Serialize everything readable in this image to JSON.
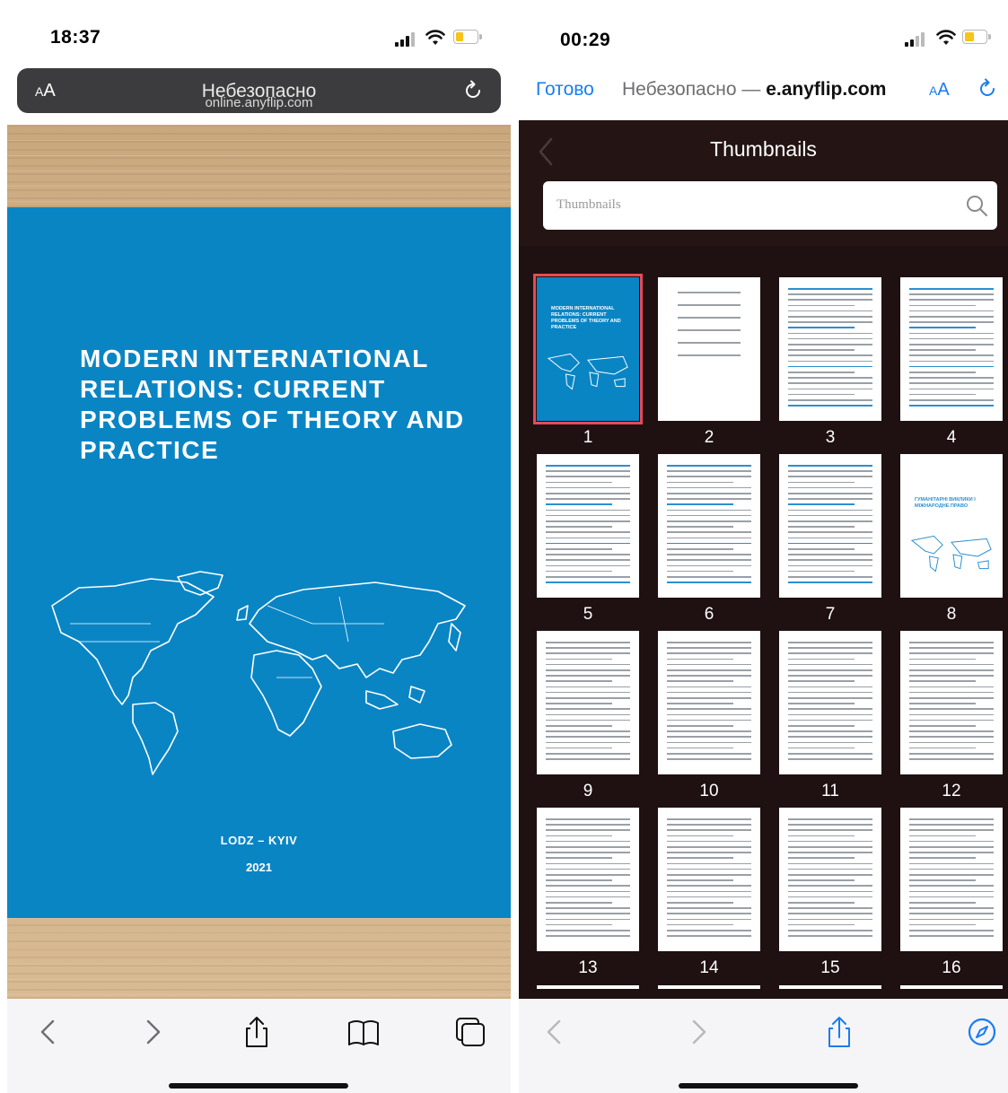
{
  "left_phone": {
    "status": {
      "time": "18:37"
    },
    "url_bar": {
      "text_size_label": "AA",
      "security_text": "Небезопасно",
      "domain": "online.anyflip.com"
    },
    "cover": {
      "title": "MODERN INTERNATIONAL RELATIONS: CURRENT PROBLEMS OF THEORY AND PRACTICE",
      "place": "LODZ – KYIV",
      "year": "2021"
    },
    "toolbar": [
      "back-icon",
      "forward-icon",
      "share-icon",
      "bookmarks-icon",
      "tabs-icon"
    ]
  },
  "right_phone": {
    "status": {
      "time": "00:29"
    },
    "url_bar": {
      "done_label": "Готово",
      "security_prefix": "Небезопасно — ",
      "domain_partial": "e.anyflip.com",
      "text_size_label": "AA"
    },
    "panel": {
      "title": "Thumbnails",
      "search_placeholder": "Thumbnails"
    },
    "thumbnail_pages": [
      "1",
      "2",
      "3",
      "4",
      "5",
      "6",
      "7",
      "8",
      "9",
      "10",
      "11",
      "12",
      "13",
      "14",
      "15",
      "16"
    ],
    "page8_title": "ГУМАНІТАРНІ ВИКЛИКИ І МІЖНАРОДНЕ ПРАВО",
    "selected_page": "1",
    "toolbar": [
      "back-icon",
      "forward-icon",
      "share-icon",
      "compass-icon"
    ]
  },
  "colors": {
    "cover_blue": "#0a85c4",
    "ios_blue": "#1a7cf2",
    "selection_red": "#e64a56",
    "panel_bg": "#1f1111"
  }
}
